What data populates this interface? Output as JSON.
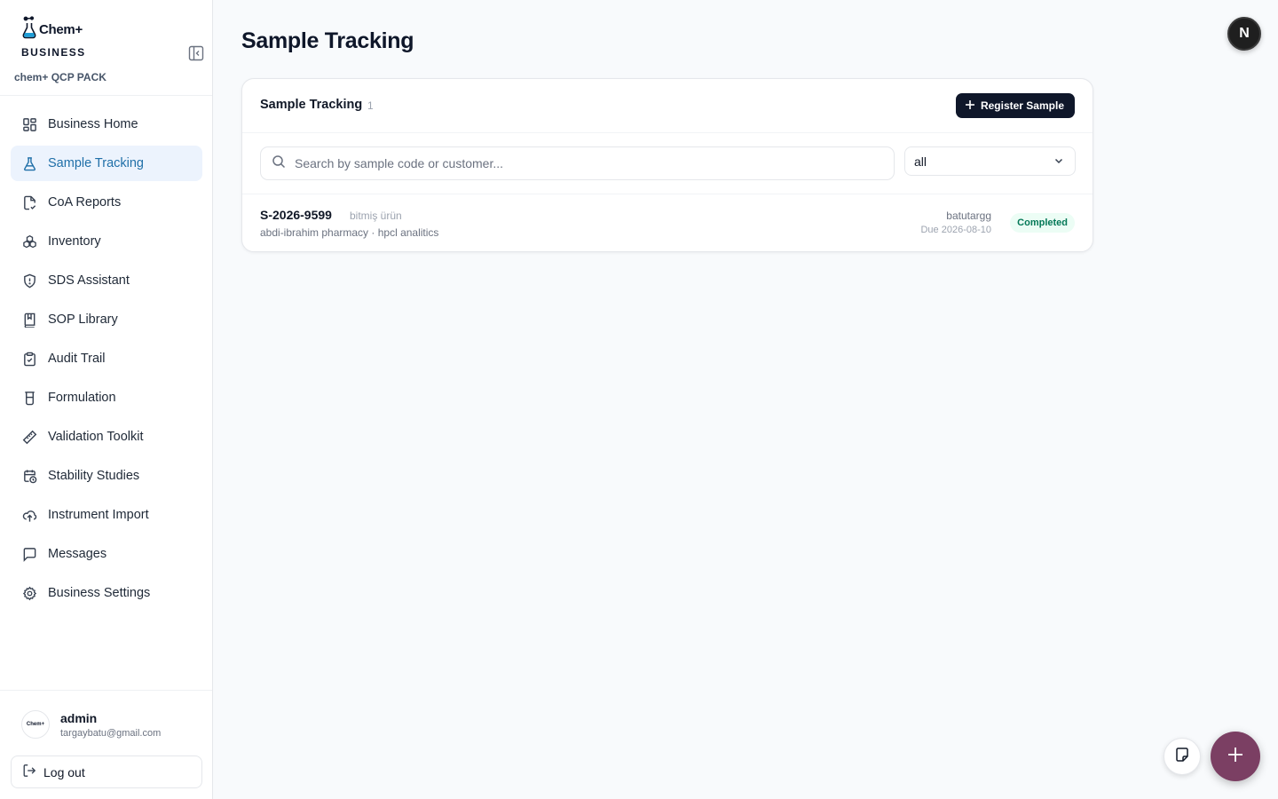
{
  "brand": {
    "logo_text": "Chem+",
    "subtitle": "BUSINESS",
    "pack": "chem+ QCP PACK"
  },
  "nav": {
    "items": [
      {
        "label": "Business Home",
        "icon": "grid-icon"
      },
      {
        "label": "Sample Tracking",
        "icon": "flask-icon",
        "active": true
      },
      {
        "label": "CoA Reports",
        "icon": "file-check-icon"
      },
      {
        "label": "Inventory",
        "icon": "boxes-icon"
      },
      {
        "label": "SDS Assistant",
        "icon": "shield-alert-icon"
      },
      {
        "label": "SOP Library",
        "icon": "book-icon"
      },
      {
        "label": "Audit Trail",
        "icon": "clipboard-check-icon"
      },
      {
        "label": "Formulation",
        "icon": "beaker-icon"
      },
      {
        "label": "Validation Toolkit",
        "icon": "ruler-icon"
      },
      {
        "label": "Stability Studies",
        "icon": "calendar-clock-icon"
      },
      {
        "label": "Instrument Import",
        "icon": "cloud-upload-icon"
      },
      {
        "label": "Messages",
        "icon": "message-icon"
      },
      {
        "label": "Business Settings",
        "icon": "gear-icon"
      }
    ]
  },
  "user": {
    "avatar_text": "Chem+",
    "name": "admin",
    "email": "targaybatu@gmail.com",
    "logout_label": "Log out"
  },
  "header": {
    "title": "Sample Tracking",
    "avatar_letter": "N"
  },
  "card": {
    "title": "Sample Tracking",
    "count": "1",
    "register_label": "Register Sample",
    "search_placeholder": "Search by sample code or customer...",
    "filter_value": "all"
  },
  "samples": [
    {
      "code": "S-2026-9599",
      "type": "bitmiş ürün",
      "subtitle": "abdi-ibrahim pharmacy · hpcl analitics",
      "user": "batutargg",
      "due": "Due 2026-08-10",
      "status": "Completed"
    }
  ],
  "colors": {
    "accent": "#1f6fa8",
    "active_bg": "#ecf3fd",
    "primary_button": "#0f172a",
    "fab": "#7b3f63",
    "status_completed_bg": "#ecfdf5",
    "status_completed_text": "#047857"
  }
}
